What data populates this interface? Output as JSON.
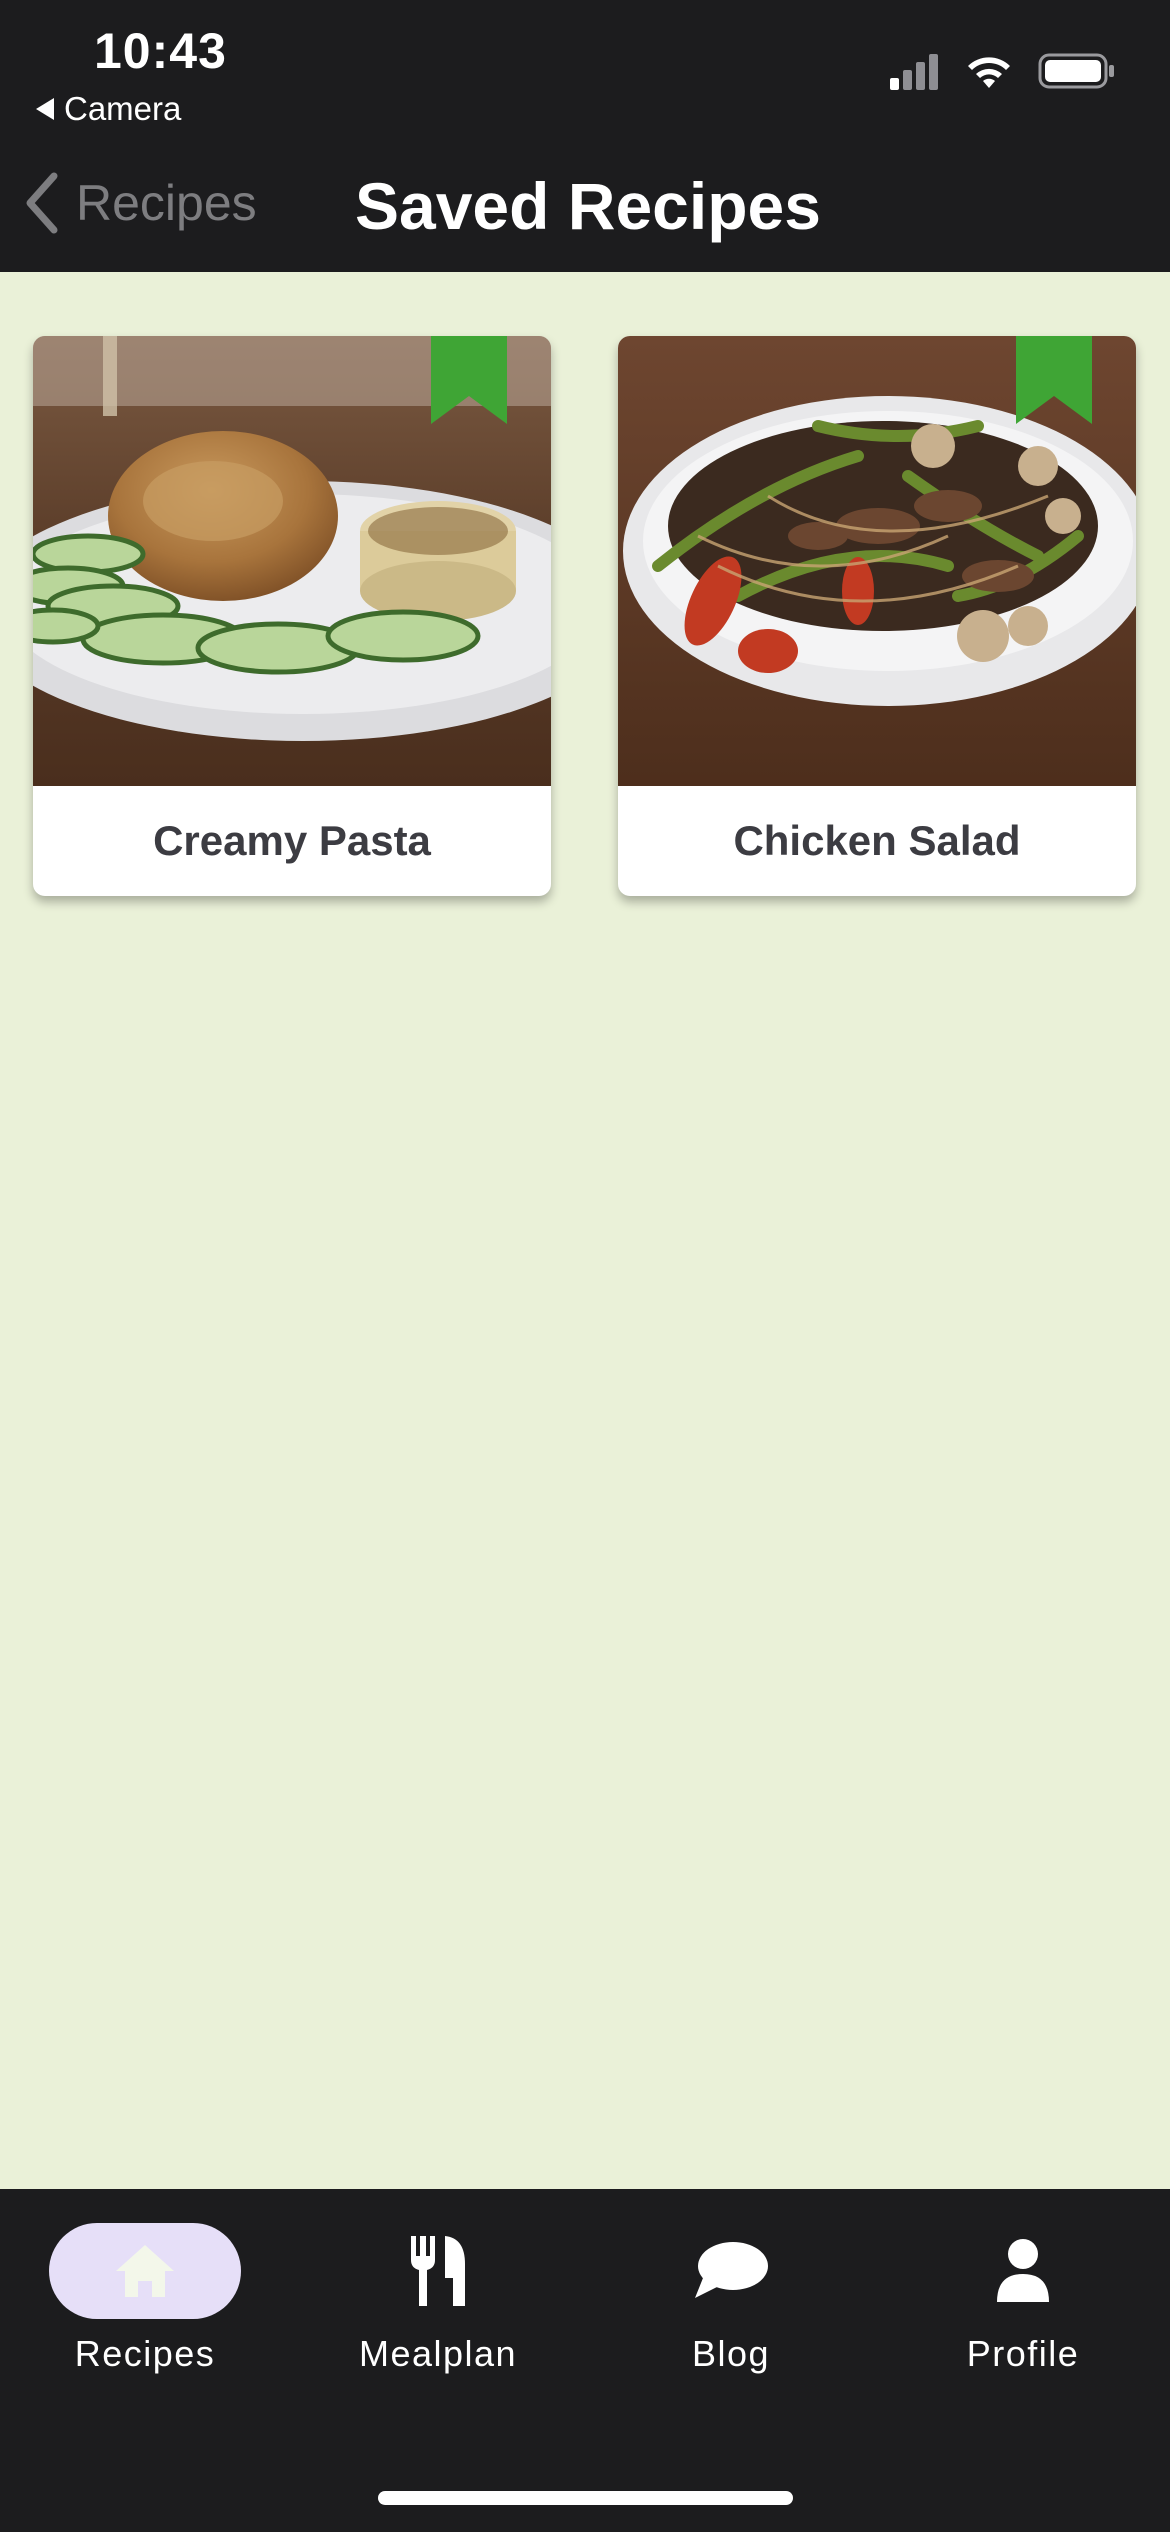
{
  "status_bar": {
    "time": "10:43",
    "back_app": "Camera",
    "icons": [
      "cellular-signal-icon",
      "wifi-icon",
      "battery-icon"
    ]
  },
  "nav": {
    "back_label": "Recipes",
    "title": "Saved Recipes"
  },
  "recipes": [
    {
      "name": "Creamy Pasta",
      "saved": true,
      "image": "grilled chicken with cucumber slices on plate"
    },
    {
      "name": "Chicken Salad",
      "saved": true,
      "image": "stir-fried noodles with vegetables in bowl"
    }
  ],
  "tabs": [
    {
      "label": "Recipes",
      "icon": "home-icon",
      "active": true
    },
    {
      "label": "Mealplan",
      "icon": "fork-knife-icon",
      "active": false
    },
    {
      "label": "Blog",
      "icon": "chat-bubble-icon",
      "active": false
    },
    {
      "label": "Profile",
      "icon": "person-icon",
      "active": false
    }
  ],
  "colors": {
    "background": "#eaf1d8",
    "bars": "#1c1c1e",
    "bookmark": "#3fa535",
    "active_tab_pill": "#e6dff8"
  }
}
